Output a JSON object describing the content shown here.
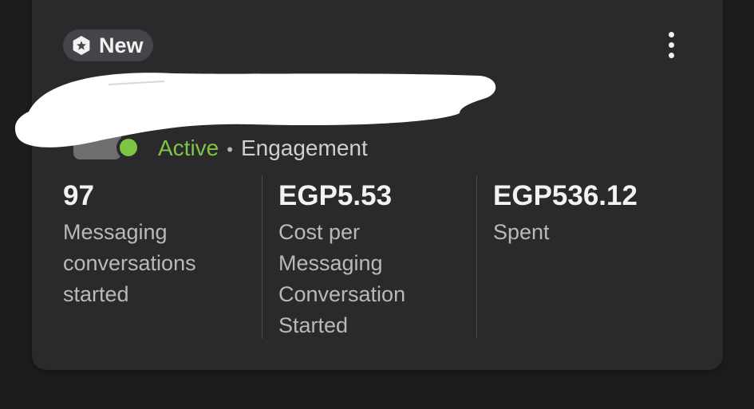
{
  "badge": {
    "label": "New",
    "icon": "star-hexagon-icon"
  },
  "menu": {
    "icon": "more-vertical-icon"
  },
  "campaign": {
    "status": "Active",
    "separator": "•",
    "objective": "Engagement",
    "status_color": "#7ec445"
  },
  "metrics": [
    {
      "value": "97",
      "label": "Messaging conversations started"
    },
    {
      "value": "EGP5.53",
      "label": "Cost per Messaging Conversation Started"
    },
    {
      "value": "EGP536.12",
      "label": "Spent"
    }
  ]
}
